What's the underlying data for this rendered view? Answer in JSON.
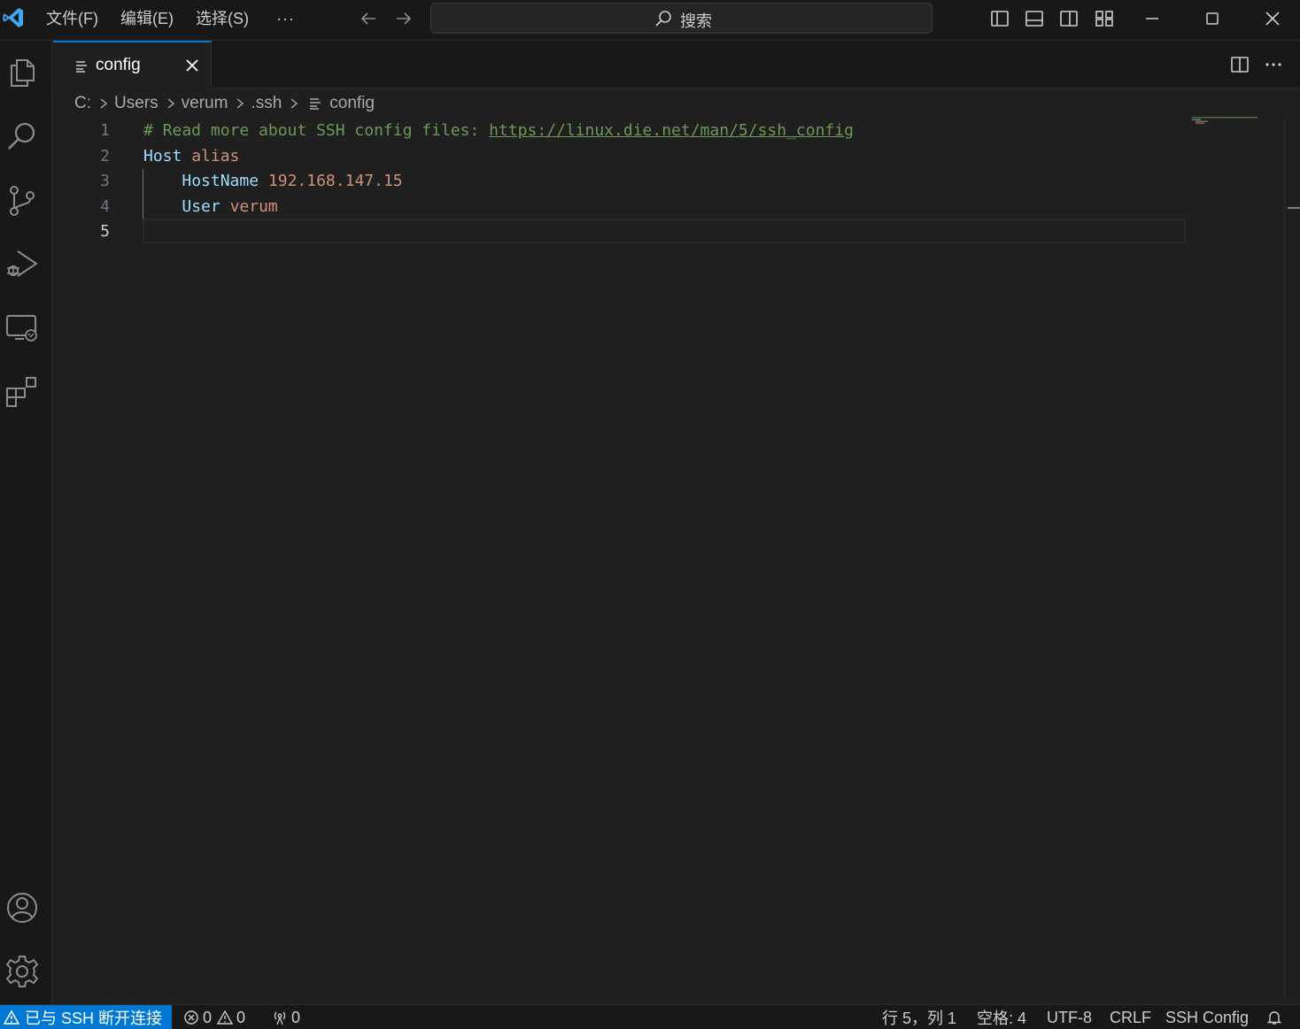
{
  "menu": {
    "file": "文件(F)",
    "edit": "编辑(E)",
    "select": "选择(S)",
    "more": "···"
  },
  "search": {
    "label": "搜索"
  },
  "tab": {
    "label": "config"
  },
  "breadcrumb": {
    "items": [
      "C:",
      "Users",
      "verum",
      ".ssh",
      "config"
    ]
  },
  "editor": {
    "active_line": 5,
    "lines": [
      {
        "number": "1",
        "tokens": [
          {
            "type": "comment",
            "text": "# Read more about SSH config files: "
          },
          {
            "type": "link",
            "text": "https://linux.die.net/man/5/ssh_config"
          }
        ]
      },
      {
        "number": "2",
        "tokens": [
          {
            "type": "key",
            "text": "Host"
          },
          {
            "type": "plain",
            "text": " "
          },
          {
            "type": "val",
            "text": "alias"
          }
        ]
      },
      {
        "number": "3",
        "tokens": [
          {
            "type": "plain",
            "text": "    "
          },
          {
            "type": "key",
            "text": "HostName"
          },
          {
            "type": "plain",
            "text": " "
          },
          {
            "type": "val",
            "text": "192.168.147.15"
          }
        ]
      },
      {
        "number": "4",
        "tokens": [
          {
            "type": "plain",
            "text": "    "
          },
          {
            "type": "key",
            "text": "User"
          },
          {
            "type": "plain",
            "text": " "
          },
          {
            "type": "val",
            "text": "verum"
          }
        ]
      },
      {
        "number": "5",
        "tokens": []
      }
    ]
  },
  "statusbar": {
    "remote": "已与 SSH 断开连接",
    "errors": "0",
    "warnings": "0",
    "ports": "0",
    "position": "行 5，列 1",
    "spaces": "空格: 4",
    "encoding": "UTF-8",
    "eol": "CRLF",
    "language": "SSH Config"
  },
  "colors": {
    "accent": "#0078d4",
    "comment": "#6a9955",
    "keyword": "#9cdcfe",
    "value": "#ce9178",
    "logo": "#3fa6f0"
  },
  "icons": {
    "activity": [
      "explorer-icon",
      "search-icon",
      "source-control-icon",
      "run-debug-icon",
      "remote-explorer-icon",
      "extensions-icon",
      "account-icon",
      "manage-gear-icon"
    ]
  }
}
